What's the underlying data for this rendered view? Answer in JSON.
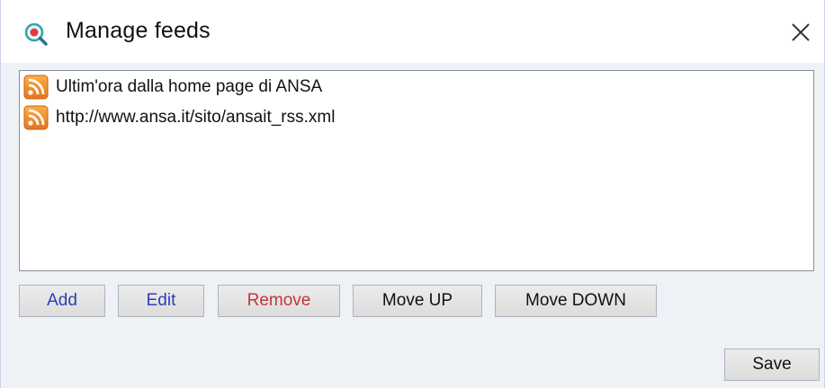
{
  "window": {
    "title": "Manage feeds",
    "app_icon": "search-magnifier-icon",
    "close_icon": "close-icon"
  },
  "feeds": [
    {
      "label": "Ultim'ora dalla home page di ANSA",
      "icon": "rss-icon"
    },
    {
      "label": "http://www.ansa.it/sito/ansait_rss.xml",
      "icon": "rss-icon"
    }
  ],
  "buttons": {
    "add": "Add",
    "edit": "Edit",
    "remove": "Remove",
    "move_up": "Move UP",
    "move_down": "Move DOWN",
    "save": "Save"
  },
  "colors": {
    "add_edit_text": "#2c3fb8",
    "remove_text": "#c4343c",
    "rss_orange": "#f08a24",
    "panel_background": "#eef1f6"
  }
}
